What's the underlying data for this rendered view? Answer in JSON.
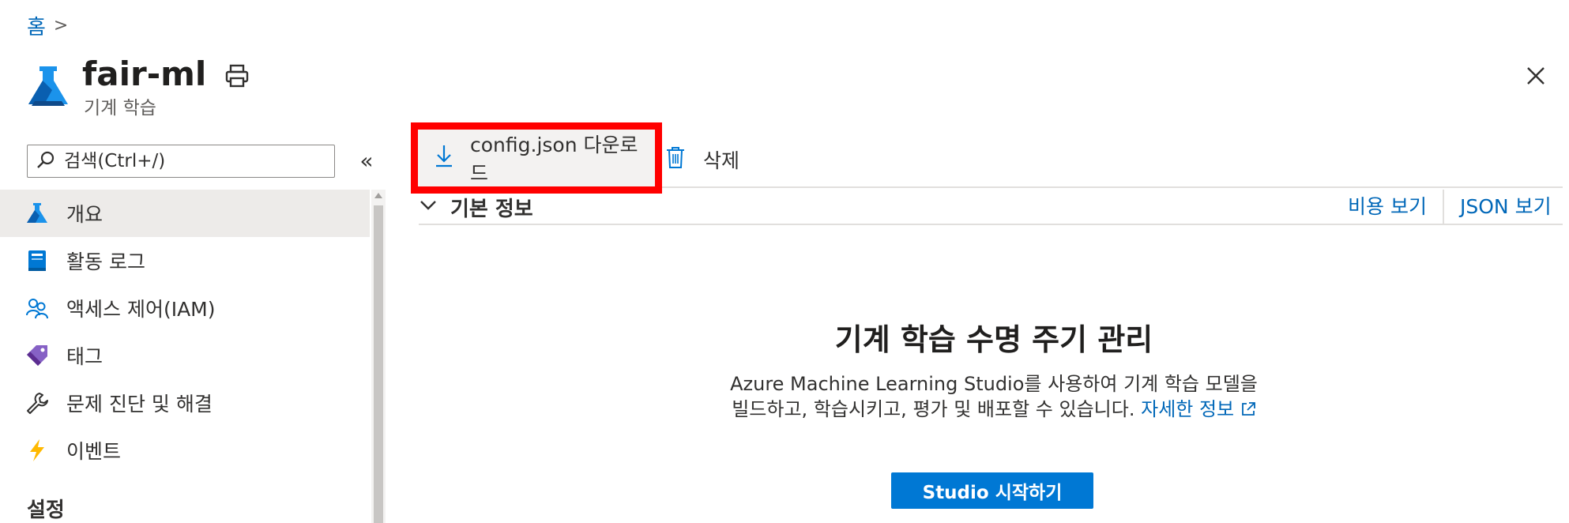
{
  "breadcrumb": {
    "home": "홈",
    "separator": ">"
  },
  "header": {
    "title": "fair-ml",
    "subtitle": "기계 학습",
    "logo_icon": "azure-ml-flask-icon",
    "print_icon": "print-icon",
    "close_icon": "close-icon"
  },
  "search": {
    "placeholder": "검색(Ctrl+/)",
    "collapse_icon": "«"
  },
  "nav": {
    "items": [
      {
        "label": "개요",
        "icon": "flask-icon",
        "selected": true
      },
      {
        "label": "활동 로그",
        "icon": "activity-log-icon"
      },
      {
        "label": "액세스 제어(IAM)",
        "icon": "people-icon"
      },
      {
        "label": "태그",
        "icon": "tag-icon"
      },
      {
        "label": "문제 진단 및 해결",
        "icon": "wrench-icon"
      },
      {
        "label": "이벤트",
        "icon": "lightning-icon"
      }
    ],
    "section_settings": "설정"
  },
  "toolbar": {
    "download_label": "config.json 다운로드",
    "delete_label": "삭제"
  },
  "essentials": {
    "label": "기본 정보",
    "cost_link": "비용 보기",
    "json_link": "JSON 보기"
  },
  "main": {
    "heading": "기계 학습 수명 주기 관리",
    "description": "Azure Machine Learning Studio를 사용하여 기계 학습 모델을 빌드하고, 학습시키고, 평가 및 배포할 수 있습니다.",
    "learn_more": "자세한 정보",
    "launch_button": "Studio 시작하기"
  },
  "colors": {
    "accent": "#0078d4",
    "link": "#0067b8",
    "highlight_box": "#ff0000",
    "selected_bg": "#edebe9"
  }
}
